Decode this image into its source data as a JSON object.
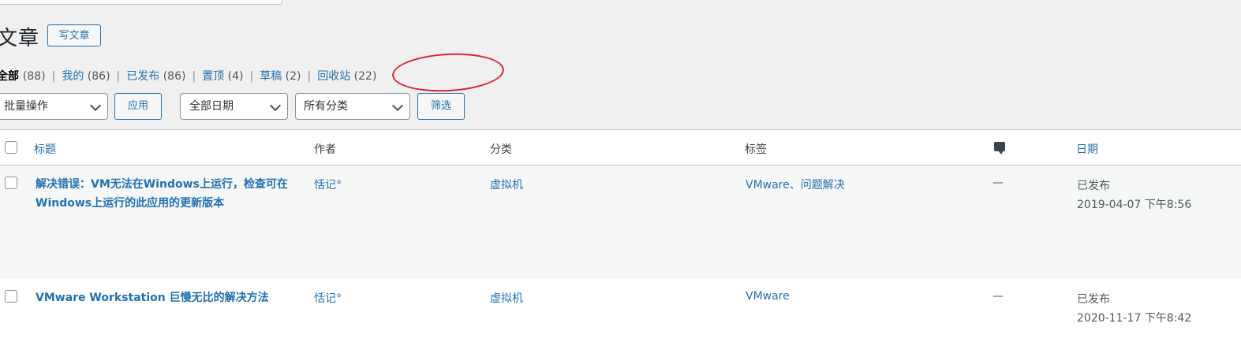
{
  "header": {
    "page_title": "文章",
    "add_new_label": "写文章"
  },
  "views": [
    {
      "label": "全部",
      "count": "(88)"
    },
    {
      "label": "我的",
      "count": "(86)"
    },
    {
      "label": "已发布",
      "count": "(86)"
    },
    {
      "label": "置顶",
      "count": "(4)"
    },
    {
      "label": "草稿",
      "count": "(2)"
    },
    {
      "label": "回收站",
      "count": "(22)"
    }
  ],
  "filters": {
    "bulk_action": "批量操作",
    "apply_label": "应用",
    "date_filter": "全部日期",
    "category_filter": "所有分类",
    "filter_label": "筛选"
  },
  "table": {
    "columns": {
      "title": "标题",
      "author": "作者",
      "categories": "分类",
      "tags": "标签",
      "comments_icon": "comment-icon",
      "date": "日期"
    },
    "rows": [
      {
        "title": "解决错误：VM无法在Windows上运行，检查可在Windows上运行的此应用的更新版本",
        "author": "恬记°",
        "category": "虚拟机",
        "tags": "VMware、问题解决",
        "comments": "—",
        "status": "已发布",
        "date": "2019-04-07 下午8:56"
      },
      {
        "title": "VMware Workstation 巨慢无比的解决方法",
        "author": "恬记°",
        "category": "虚拟机",
        "tags": "VMware",
        "comments": "—",
        "status": "已发布",
        "date": "2020-11-17 下午8:42"
      }
    ]
  },
  "colors": {
    "accent": "#2271b1",
    "highlight_circle": "#d9262a",
    "background": "#f0f0f1"
  }
}
